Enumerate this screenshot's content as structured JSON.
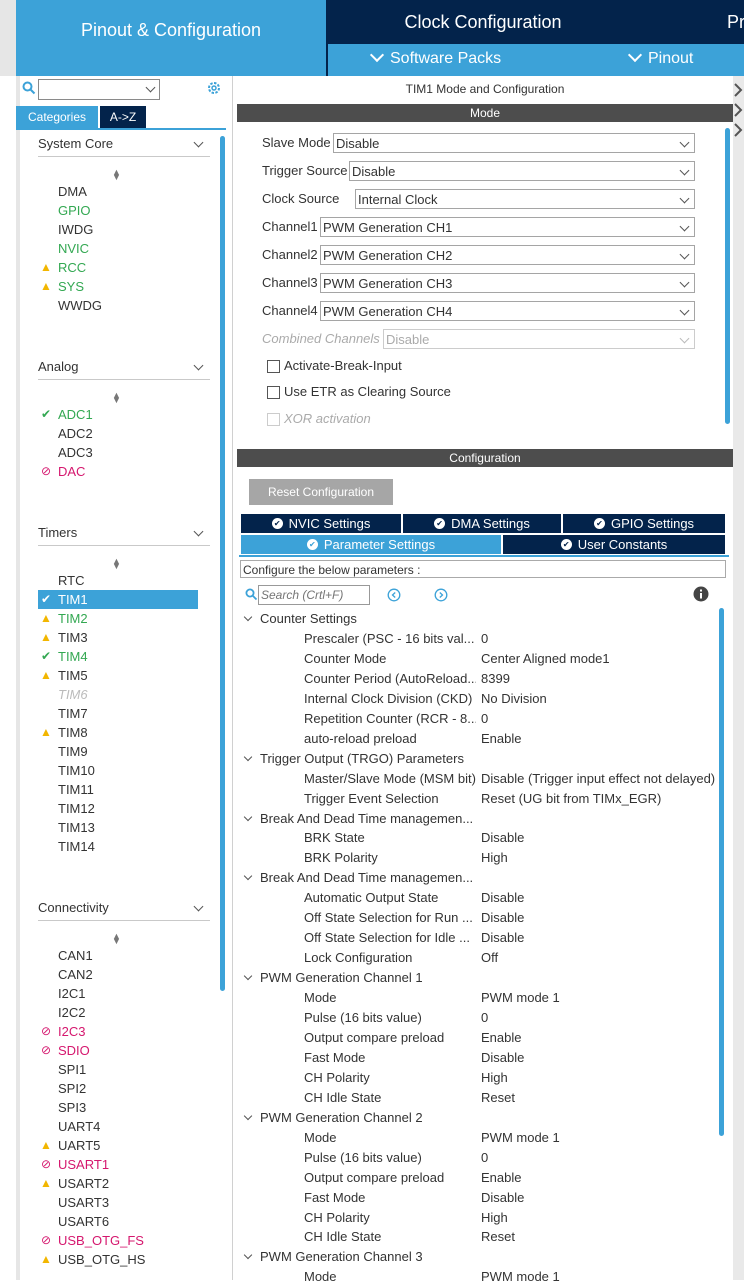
{
  "tabs": {
    "pinout": "Pinout & Configuration",
    "clock": "Clock Configuration",
    "project": "Pr"
  },
  "subbar": {
    "software_packs": "Software Packs",
    "pinout": "Pinout"
  },
  "left": {
    "cat_tab_categories": "Categories",
    "cat_tab_az": "A->Z",
    "sections": {
      "system_core": {
        "title": "System Core",
        "items": [
          "DMA",
          "GPIO",
          "IWDG",
          "NVIC",
          "RCC",
          "SYS",
          "WWDG"
        ]
      },
      "analog": {
        "title": "Analog",
        "items": [
          "ADC1",
          "ADC2",
          "ADC3",
          "DAC"
        ]
      },
      "timers": {
        "title": "Timers",
        "items": [
          "RTC",
          "TIM1",
          "TIM2",
          "TIM3",
          "TIM4",
          "TIM5",
          "TIM6",
          "TIM7",
          "TIM8",
          "TIM9",
          "TIM10",
          "TIM11",
          "TIM12",
          "TIM13",
          "TIM14"
        ]
      },
      "connectivity": {
        "title": "Connectivity",
        "items": [
          "CAN1",
          "CAN2",
          "I2C1",
          "I2C2",
          "I2C3",
          "SDIO",
          "SPI1",
          "SPI2",
          "SPI3",
          "UART4",
          "UART5",
          "USART1",
          "USART2",
          "USART3",
          "USART6",
          "USB_OTG_FS",
          "USB_OTG_HS"
        ]
      }
    }
  },
  "right": {
    "title": "TIM1 Mode and Configuration",
    "mode_header": "Mode",
    "mode_rows": [
      {
        "label": "Slave Mode",
        "value": "Disable"
      },
      {
        "label": "Trigger Source",
        "value": "Disable"
      },
      {
        "label": "Clock Source",
        "value": "Internal Clock"
      },
      {
        "label": "Channel1",
        "value": "PWM Generation CH1"
      },
      {
        "label": "Channel2",
        "value": "PWM Generation CH2"
      },
      {
        "label": "Channel3",
        "value": "PWM Generation CH3"
      },
      {
        "label": "Channel4",
        "value": "PWM Generation CH4"
      },
      {
        "label": "Combined Channels",
        "value": "Disable"
      }
    ],
    "checks": [
      "Activate-Break-Input",
      "Use ETR as Clearing Source",
      "XOR activation"
    ],
    "config_header": "Configuration",
    "reset_button": "Reset Configuration",
    "cfg_tabs": [
      "NVIC Settings",
      "DMA Settings",
      "GPIO Settings",
      "Parameter Settings",
      "User Constants"
    ],
    "configure_text": "Configure the below parameters :",
    "search_placeholder": "Search (Crtl+F)",
    "groups": [
      {
        "name": "Counter Settings",
        "rows": [
          [
            "Prescaler (PSC - 16 bits val...",
            "0"
          ],
          [
            "Counter Mode",
            "Center Aligned mode1"
          ],
          [
            "Counter Period (AutoReload...",
            "8399"
          ],
          [
            "Internal Clock Division (CKD)",
            "No Division"
          ],
          [
            "Repetition Counter (RCR - 8...",
            "0"
          ],
          [
            "auto-reload preload",
            "Enable"
          ]
        ]
      },
      {
        "name": "Trigger Output (TRGO) Parameters",
        "rows": [
          [
            "Master/Slave Mode (MSM bit)",
            "Disable (Trigger input effect not delayed)"
          ],
          [
            "Trigger Event Selection",
            "Reset (UG bit from TIMx_EGR)"
          ]
        ]
      },
      {
        "name": "Break And Dead Time managemen...",
        "rows": [
          [
            "BRK State",
            "Disable"
          ],
          [
            "BRK Polarity",
            "High"
          ]
        ]
      },
      {
        "name": "Break And Dead Time managemen...",
        "rows": [
          [
            "Automatic Output State",
            "Disable"
          ],
          [
            "Off State Selection for Run ...",
            "Disable"
          ],
          [
            "Off State Selection for Idle ...",
            "Disable"
          ],
          [
            "Lock Configuration",
            "Off"
          ]
        ]
      },
      {
        "name": "PWM Generation Channel 1",
        "rows": [
          [
            "Mode",
            "PWM mode 1"
          ],
          [
            "Pulse (16 bits value)",
            "0"
          ],
          [
            "Output compare preload",
            "Enable"
          ],
          [
            "Fast Mode",
            "Disable"
          ],
          [
            "CH Polarity",
            "High"
          ],
          [
            "CH Idle State",
            "Reset"
          ]
        ]
      },
      {
        "name": "PWM Generation Channel 2",
        "rows": [
          [
            "Mode",
            "PWM mode 1"
          ],
          [
            "Pulse (16 bits value)",
            "0"
          ],
          [
            "Output compare preload",
            "Enable"
          ],
          [
            "Fast Mode",
            "Disable"
          ],
          [
            "CH Polarity",
            "High"
          ],
          [
            "CH Idle State",
            "Reset"
          ]
        ]
      },
      {
        "name": "PWM Generation Channel 3",
        "rows": [
          [
            "Mode",
            "PWM mode 1"
          ]
        ]
      }
    ]
  },
  "colors": {
    "accent": "#3ca2d8",
    "navy": "#03234b",
    "ok_green": "#33a852",
    "error_pink": "#d5176e",
    "warning_yellow": "#f2b600"
  }
}
